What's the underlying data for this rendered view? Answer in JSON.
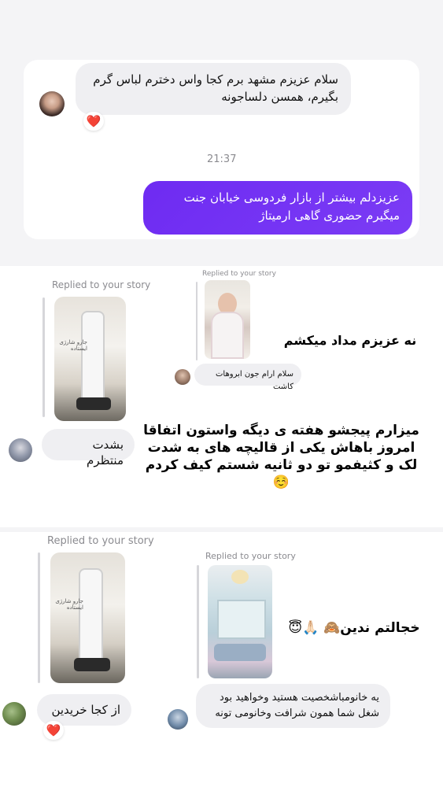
{
  "colors": {
    "accent_purple": "#7231f3",
    "bubble_gray": "#efeff2",
    "heart_red": "#e6253a",
    "card_white": "#ffffff"
  },
  "chat1": {
    "incoming_message": "سلام عزیزم مشهد برم کجا واس دخترم لباس گرم بگیرم، همسن دلساجونه",
    "reaction": "❤️",
    "timestamp": "21:37",
    "outgoing_message": "عزیزدلم بیشتر از بازار فردوسی خیابان جنت میگیرم حضوری گاهی ارمیتاژ"
  },
  "story1": {
    "left": {
      "replied_label": "Replied to your story",
      "message": "بشدت منتظرم",
      "thumb_caption": "جارو شارژی ایستاده"
    },
    "right": {
      "replied_label": "Replied to your story",
      "message": "سلام ارام جون ابروهات کاشت"
    },
    "overlay_top": "نه عزیزم مداد میکشم",
    "overlay_bottom": "میزارم پیجشو هفته ی دیگه واستون اتفاقا امروز باهاش یکی از قالیچه های به شدت لک و کثیفمو تو دو ثانیه شستم کیف کردم☺️"
  },
  "story2": {
    "left": {
      "replied_label": "Replied to your story",
      "message": "از کجا خریدین",
      "reaction": "❤️",
      "thumb_caption": "جارو شارژی ایستاده"
    },
    "right": {
      "replied_label": "Replied to your story",
      "message": "یه خانومباشخصیت هستید وخواهید بود شغل شما همون شرافت وخانومی تونه"
    },
    "overlay": "خجالتم ندین🙈 🙏🏻😇"
  },
  "icons": {
    "reaction": "heart-icon",
    "avatar": "avatar-photo"
  }
}
